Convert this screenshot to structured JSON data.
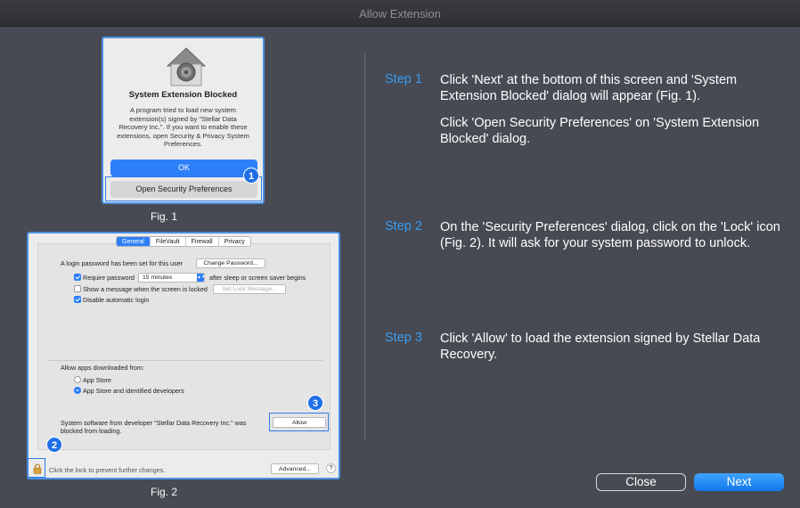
{
  "window": {
    "title": "Allow Extension"
  },
  "fig1": {
    "dialog_title": "System Extension Blocked",
    "dialog_body": "A program tried to load new system extension(s) signed by \"Stellar Data Recovery Inc.\". If you want to enable these extensions, open Security & Privacy System Preferences.",
    "ok_label": "OK",
    "open_security_label": "Open Security Preferences",
    "callout": "1",
    "caption": "Fig. 1"
  },
  "fig2": {
    "tabs": [
      "General",
      "FileVault",
      "Firewall",
      "Privacy"
    ],
    "login_password_text": "A login password has been set for this user",
    "change_password_label": "Change Password...",
    "require_password_label": "Require password",
    "require_password_value": "15 minutes",
    "after_sleep_text": "after sleep or screen saver begins",
    "show_message_label": "Show a message when the screen is locked",
    "set_lock_message_label": "Set Lock Message...",
    "disable_auto_login_label": "Disable automatic login",
    "allow_apps_text": "Allow apps downloaded from:",
    "app_store_label": "App Store",
    "app_store_identified_label": "App Store and identified developers",
    "blocked_text_line1": "System software from developer \"Stellar Data Recovery Inc.\" was",
    "blocked_text_line2": "blocked from loading.",
    "allow_label": "Allow",
    "lock_text": "Click the lock to prevent further changes.",
    "advanced_label": "Advanced...",
    "help_label": "?",
    "callout_lock": "2",
    "callout_allow": "3",
    "caption": "Fig. 2"
  },
  "steps": [
    {
      "label": "Step 1",
      "text": "Click 'Next' at the bottom of this screen and 'System Extension Blocked' dialog will appear (Fig. 1).",
      "text2": "Click 'Open Security Preferences' on 'System Extension Blocked' dialog."
    },
    {
      "label": "Step 2",
      "text": "On the 'Security Preferences' dialog, click on the 'Lock' icon (Fig. 2). It will ask for your system password to unlock."
    },
    {
      "label": "Step 3",
      "text": "Click 'Allow' to load the extension signed by Stellar Data Recovery."
    }
  ],
  "buttons": {
    "close": "Close",
    "next": "Next"
  },
  "colors": {
    "accent": "#3a9cf0",
    "background": "#474a52",
    "highlight": "#2f7de8"
  }
}
